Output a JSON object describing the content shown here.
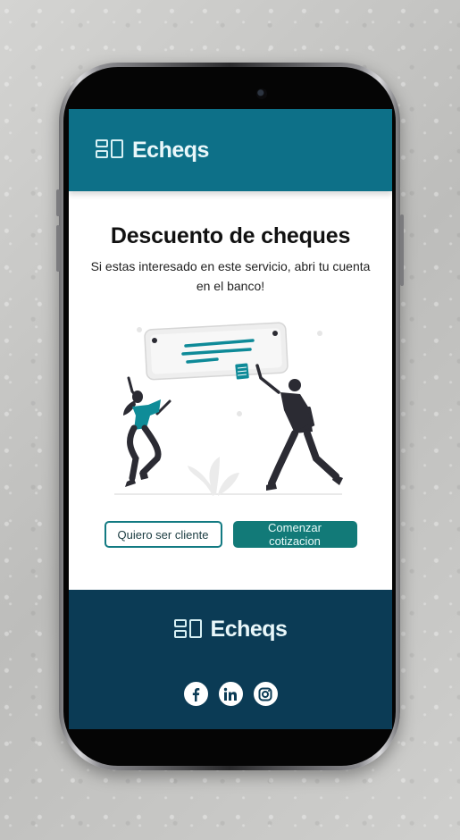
{
  "app": {
    "brand": "Echeqs"
  },
  "header": {
    "logo_text": "Echeqs"
  },
  "main": {
    "title": "Descuento de cheques",
    "subtitle": "Si estas interesado en este servicio, abri tu cuenta en el banco!"
  },
  "actions": {
    "client_label": "Quiero ser cliente",
    "quote_label": "Comenzar cotizacion"
  },
  "footer": {
    "logo_text": "Echeqs",
    "social": [
      {
        "icon": "facebook-icon"
      },
      {
        "icon": "linkedin-icon"
      },
      {
        "icon": "instagram-icon"
      }
    ]
  },
  "colors": {
    "header_bg": "#0d7088",
    "footer_bg": "#0b3b55",
    "accent": "#127a78",
    "check_lines": "#0e8a98"
  }
}
